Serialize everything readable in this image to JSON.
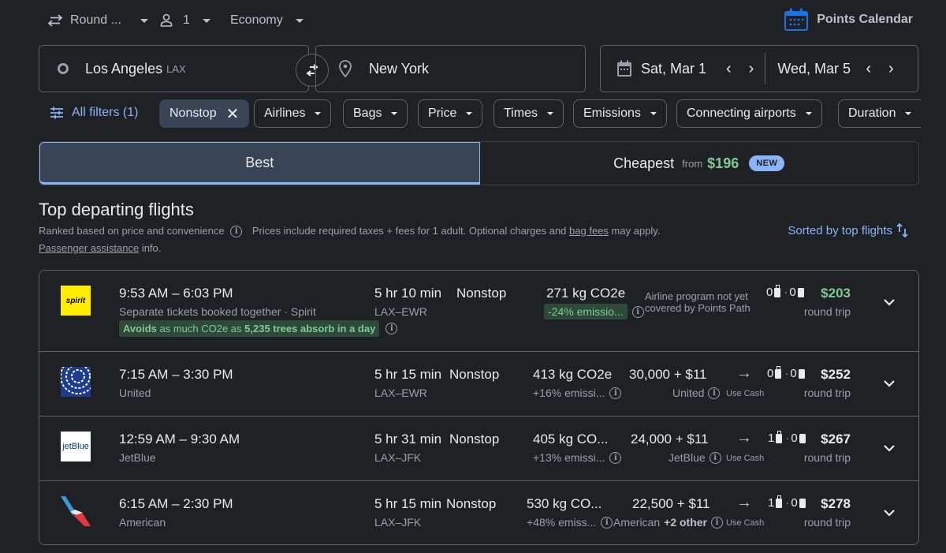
{
  "topbar": {
    "trip_type": "Round ...",
    "passengers": "1",
    "cabin": "Economy",
    "points_calendar": "Points Calendar",
    "accent": "#1a73e8"
  },
  "search": {
    "origin": "Los Angeles",
    "origin_code": "LAX",
    "destination": "New York",
    "depart_date": "Sat, Mar 1",
    "return_date": "Wed, Mar 5"
  },
  "filters": {
    "all_filters": "All filters (1)",
    "chips": [
      "Nonstop",
      "Airlines",
      "Bags",
      "Price",
      "Times",
      "Emissions",
      "Connecting airports",
      "Duration"
    ]
  },
  "tabs": {
    "best": "Best",
    "cheapest": "Cheapest",
    "from": "from",
    "cheapest_price": "$196",
    "new_badge": "NEW"
  },
  "section": {
    "title": "Top departing flights",
    "ranked": "Ranked based on price and convenience",
    "prices_note_1": "Prices include required taxes + fees for 1 adult. Optional charges and",
    "bag_fees": "bag fees",
    "prices_note_2": "may apply.",
    "passenger_assistance": "Passenger assistance",
    "info": "info.",
    "sorted_by": "Sorted by top flights"
  },
  "flights": [
    {
      "airline_logo": "spirit-logo",
      "logo_text": "spirit",
      "times": "9:53 AM – 6:03 PM",
      "airline": "Separate tickets booked together · Spirit",
      "eco_badge_bold1": "Avoids",
      "eco_badge_mid": " as much CO2e as ",
      "eco_badge_bold2": "5,235 trees absorb in a day",
      "duration": "5 hr 10 min",
      "route": "LAX–EWR",
      "stops": "Nonstop",
      "co2": "271 kg CO2e",
      "emissions": "-24% emissio...",
      "points_note_1": "Airline program not yet",
      "points_note_2": "covered by Points Path",
      "carry_on": "0",
      "checked": "0",
      "price": "$203",
      "price_label": "round trip"
    },
    {
      "airline_logo": "united-logo",
      "times": "7:15 AM – 3:30 PM",
      "airline": "United",
      "duration": "5 hr 15 min",
      "route": "LAX–EWR",
      "stops": "Nonstop",
      "co2": "413 kg CO2e",
      "emissions": "+16% emissi...",
      "points": "30,000 + $11",
      "points_program": "United",
      "use_cash": "Use Cash",
      "carry_on": "0",
      "checked": "0",
      "price": "$252",
      "price_label": "round trip"
    },
    {
      "airline_logo": "jetblue-logo",
      "logo_text": "jetBlue",
      "times": "12:59 AM – 9:30 AM",
      "airline": "JetBlue",
      "duration": "5 hr 31 min",
      "route": "LAX–JFK",
      "stops": "Nonstop",
      "co2": "405 kg CO...",
      "emissions": "+13% emissi...",
      "points": "24,000 + $11",
      "points_program": "JetBlue",
      "use_cash": "Use Cash",
      "carry_on": "1",
      "checked": "0",
      "price": "$267",
      "price_label": "round trip"
    },
    {
      "airline_logo": "american-logo",
      "times": "6:15 AM – 2:30 PM",
      "airline": "American",
      "duration": "5 hr 15 min",
      "route": "LAX–JFK",
      "stops": "Nonstop",
      "co2": "530 kg CO...",
      "emissions": "+48% emiss...",
      "points": "22,500 + $11",
      "points_program": "American",
      "points_program_extra": "+2 other",
      "use_cash": "Use Cash",
      "carry_on": "1",
      "checked": "0",
      "price": "$278",
      "price_label": "round trip"
    }
  ]
}
